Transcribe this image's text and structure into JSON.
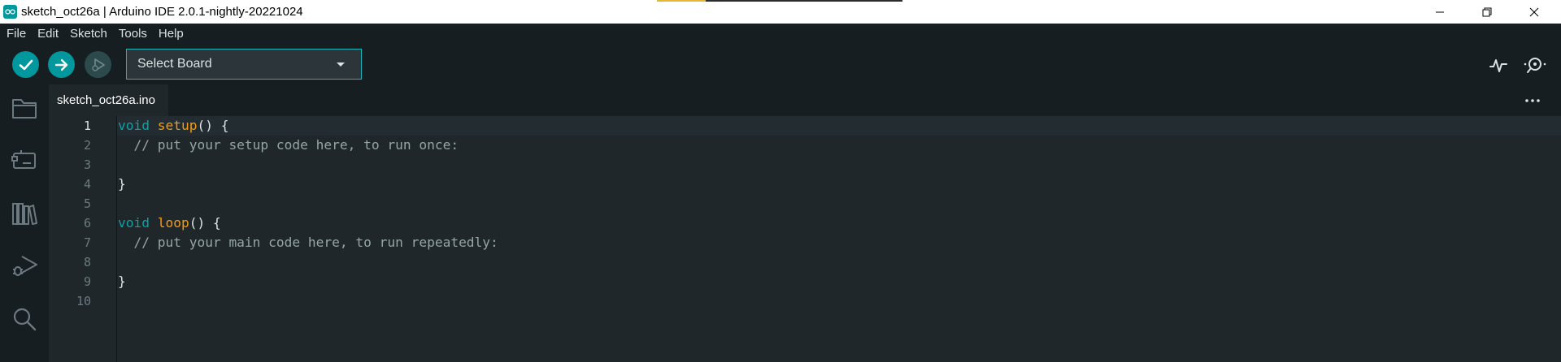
{
  "window": {
    "title": "sketch_oct26a | Arduino IDE 2.0.1-nightly-20221024"
  },
  "menu": [
    "File",
    "Edit",
    "Sketch",
    "Tools",
    "Help"
  ],
  "toolbar": {
    "verify_icon": "check-icon",
    "upload_icon": "arrow-right-icon",
    "debug_icon": "debug-icon",
    "board_select_label": "Select Board",
    "serial_plotter_icon": "pulse-icon",
    "serial_monitor_icon": "magnifier-dots-icon"
  },
  "sidebar": [
    "folder-icon",
    "boards-icon",
    "library-icon",
    "debug-icon",
    "search-icon"
  ],
  "tabs": [
    {
      "label": "sketch_oct26a.ino"
    }
  ],
  "editor": {
    "active_line": 1,
    "lines": [
      {
        "n": "1",
        "tokens": [
          {
            "t": "void",
            "c": "kw"
          },
          {
            "t": " ",
            "c": ""
          },
          {
            "t": "setup",
            "c": "fn"
          },
          {
            "t": "() {",
            "c": ""
          }
        ]
      },
      {
        "n": "2",
        "tokens": [
          {
            "t": "  // put your setup code here, to run once:",
            "c": "cm"
          }
        ]
      },
      {
        "n": "3",
        "tokens": []
      },
      {
        "n": "4",
        "tokens": [
          {
            "t": "}",
            "c": ""
          }
        ]
      },
      {
        "n": "5",
        "tokens": []
      },
      {
        "n": "6",
        "tokens": [
          {
            "t": "void",
            "c": "kw"
          },
          {
            "t": " ",
            "c": ""
          },
          {
            "t": "loop",
            "c": "fn"
          },
          {
            "t": "() {",
            "c": ""
          }
        ]
      },
      {
        "n": "7",
        "tokens": [
          {
            "t": "  // put your main code here, to run repeatedly:",
            "c": "cm"
          }
        ]
      },
      {
        "n": "8",
        "tokens": []
      },
      {
        "n": "9",
        "tokens": [
          {
            "t": "}",
            "c": ""
          }
        ]
      },
      {
        "n": "10",
        "tokens": []
      }
    ]
  },
  "colors": {
    "accent": "#00979d",
    "keyword": "#0ca1a6",
    "function": "#f39c12",
    "comment": "#95a5a6",
    "background": "#1f272a"
  }
}
